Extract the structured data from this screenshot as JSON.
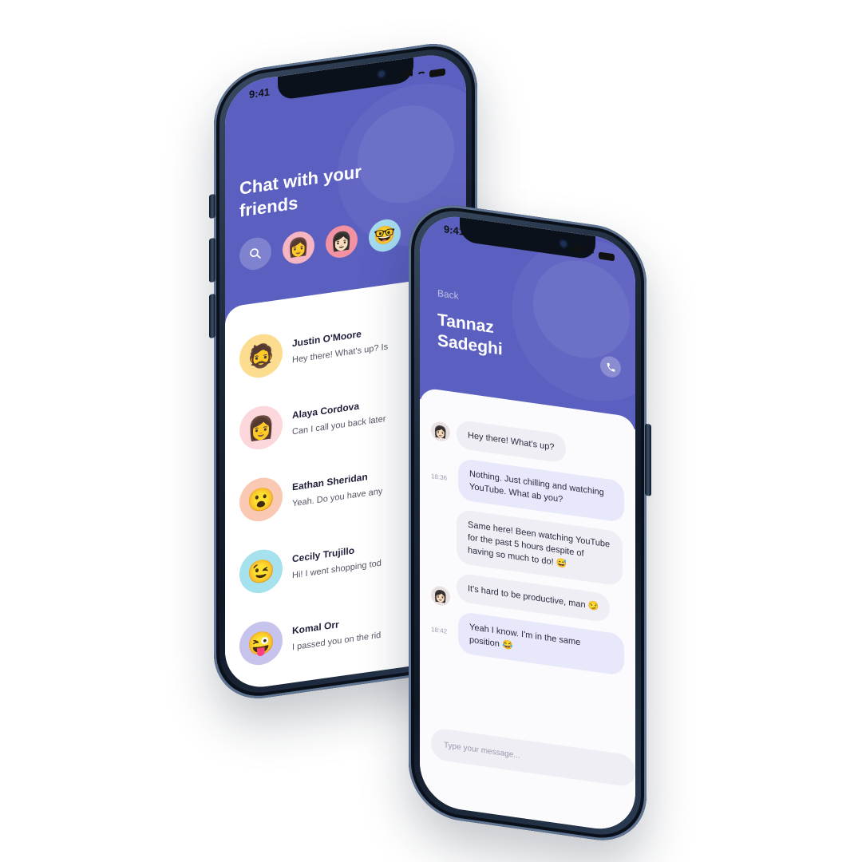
{
  "left_phone": {
    "status_time": "9:41",
    "title": "Chat with your friends",
    "stories": [
      {
        "icon": "memoji-girl-icon",
        "emoji": "👩",
        "bg": "#f6b5c3"
      },
      {
        "icon": "memoji-black-hair-icon",
        "emoji": "👩🏻",
        "bg": "#f392a2"
      },
      {
        "icon": "memoji-glasses-icon",
        "emoji": "🤓",
        "bg": "#a4dbef"
      }
    ],
    "chats": [
      {
        "name": "Justin O'Moore",
        "preview": "Hey there! What's up? Is",
        "emoji": "🧔",
        "bg": "#fcdc8f"
      },
      {
        "name": "Alaya Cordova",
        "preview": "Can I call you back later",
        "emoji": "👩",
        "bg": "#fcd7dc"
      },
      {
        "name": "Eathan Sheridan",
        "preview": "Yeah. Do you have any",
        "emoji": "😮",
        "bg": "#f9c9b3"
      },
      {
        "name": "Cecily Trujillo",
        "preview": "Hi! I went shopping tod",
        "emoji": "😉",
        "bg": "#a6e2ee"
      },
      {
        "name": "Komal Orr",
        "preview": "I passed you on the rid",
        "emoji": "😜",
        "bg": "#c6c3ec"
      }
    ]
  },
  "right_phone": {
    "status_time": "9:41",
    "back_label": "Back",
    "contact_name": "Tannaz Sadeghi",
    "messages": [
      {
        "dir": "in",
        "text": "Hey there! What's up?",
        "avatar": true
      },
      {
        "dir": "out",
        "text": "Nothing. Just chilling and watching YouTube. What ab you?",
        "time": "18:36"
      },
      {
        "dir": "in",
        "text": "Same here! Been watching YouTube for the past 5 hours despite of having so much to do! 😅"
      },
      {
        "dir": "in",
        "text": "It's hard to be productive, man 😏",
        "avatar": true
      },
      {
        "dir": "out",
        "text": "Yeah I know. I'm in the same position 😂",
        "time": "18:42"
      }
    ],
    "composer_placeholder": "Type your message..."
  },
  "colors": {
    "accent": "#5b5fc0",
    "bubble_in": "#eeeef4",
    "bubble_out": "#e8e8fb"
  }
}
